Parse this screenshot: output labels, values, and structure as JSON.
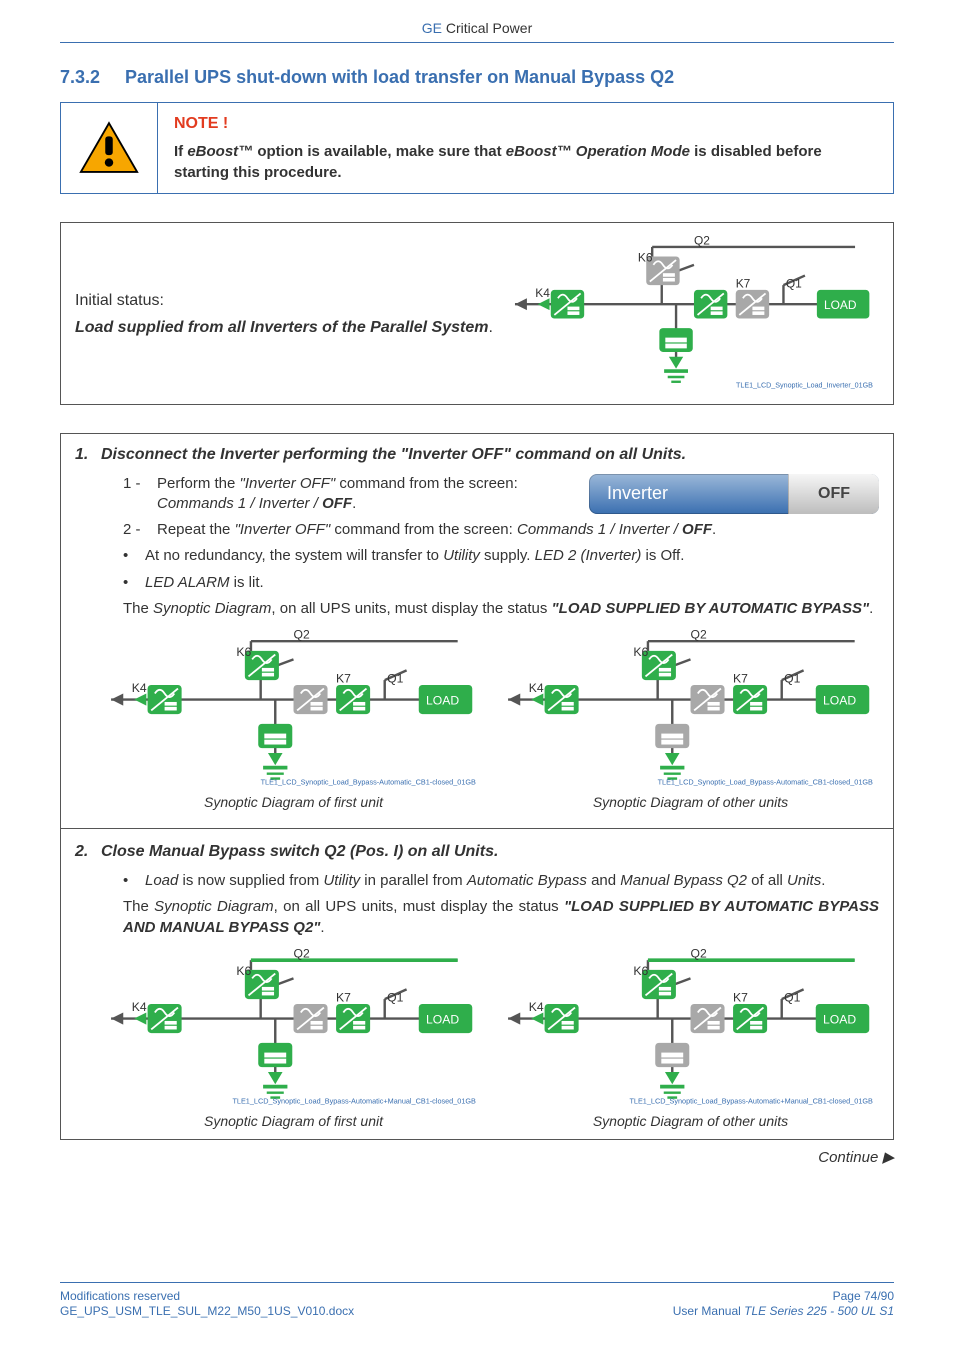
{
  "header": {
    "ge": "GE",
    "product": "Critical Power"
  },
  "section": {
    "number": "7.3.2",
    "title": "Parallel UPS shut-down with load transfer on Manual Bypass Q2"
  },
  "note": {
    "title": "NOTE !",
    "line1_a": "If ",
    "line1_b": "eBoost™",
    "line1_c": " option is available, make sure that ",
    "line1_d": "eBoost™ Operation Mode",
    "line1_e": " is disabled before starting this procedure."
  },
  "initial": {
    "label": "Initial status:",
    "text": "Load supplied from all Inverters of the Parallel System",
    "dot": ".",
    "diagram_ref": "TLE1_LCD_Synoptic_Load_Inverter_01GB"
  },
  "step1": {
    "num": "1.",
    "title": "Disconnect the Inverter performing the \"Inverter OFF\" command on all Units.",
    "sub1_num": "1 -",
    "sub1_a": "Perform the ",
    "sub1_b": "\"Inverter OFF\"",
    "sub1_c": " command from the screen: ",
    "sub1_d": "Commands 1 / Inverter / ",
    "sub1_e": "OFF",
    "sub1_f": ".",
    "sub2_num": "2 -",
    "sub2_a": "Repeat the ",
    "sub2_b": "\"Inverter OFF\"",
    "sub2_c": " command from the screen: ",
    "sub2_d": "Commands 1 / Inverter / ",
    "sub2_e": "OFF",
    "sub2_f": ".",
    "b1_a": "At no redundancy, the system will transfer to ",
    "b1_b": "Utility",
    "b1_c": " supply. ",
    "b1_d": "LED 2 (Inverter)",
    "b1_e": " is Off.",
    "b2_a": "LED ALARM",
    "b2_b": " is lit.",
    "para_a": "The ",
    "para_b": "Synoptic Diagram",
    "para_c": ", on all UPS units, must display the status ",
    "para_d": "\"LOAD SUPPLIED BY AUTOMATIC BYPASS\"",
    "para_e": ".",
    "inverter_label": "Inverter",
    "inverter_btn": "OFF",
    "cap1": "Synoptic Diagram of first unit",
    "cap2": "Synoptic Diagram of other units",
    "dref": "TLE1_LCD_Synoptic_Load_Bypass-Automatic_CB1-closed_01GB"
  },
  "step2": {
    "num": "2.",
    "title": "Close Manual Bypass switch Q2 (Pos. I) on all Units.",
    "b1_a": "Load",
    "b1_b": " is now supplied from ",
    "b1_c": "Utility",
    "b1_d": " in parallel from ",
    "b1_e": "Automatic Bypass",
    "b1_f": " and ",
    "b1_g": "Manual Bypass Q2",
    "b1_h": " of all ",
    "b1_i": "Units",
    "b1_j": ".",
    "para_a": "The ",
    "para_b": "Synoptic Diagram",
    "para_c": ", on all UPS units, must display the status ",
    "para_d": "\"LOAD SUPPLIED BY AUTOMATIC BYPASS AND MANUAL BYPASS Q2\"",
    "para_e": ".",
    "cap1": "Synoptic Diagram of first unit",
    "cap2": "Synoptic Diagram of other units",
    "dref": "TLE1_LCD_Synoptic_Load_Bypass-Automatic+Manual_CB1-closed_01GB"
  },
  "continue": "Continue ▶",
  "footer": {
    "l1": "Modifications reserved",
    "l2": "GE_UPS_USM_TLE_SUL_M22_M50_1US_V010.docx",
    "r1": "Page 74/90",
    "r2_a": "User Manual ",
    "r2_b": "TLE Series 225 - 500 UL S1"
  },
  "svg_labels": {
    "Q2": "Q2",
    "K6": "K6",
    "K4": "K4",
    "K7": "K7",
    "Q1": "Q1",
    "LOAD": "LOAD"
  }
}
